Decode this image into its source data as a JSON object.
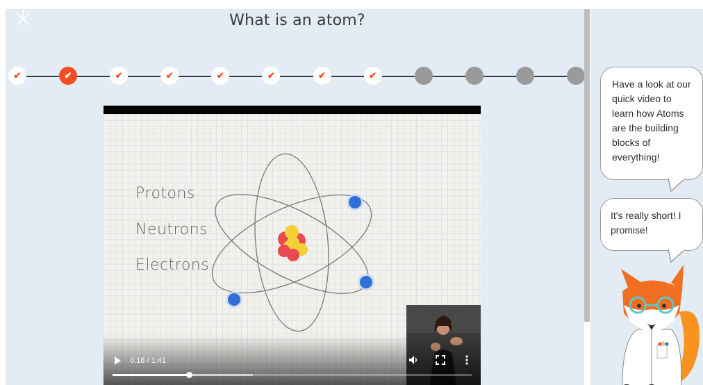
{
  "page": {
    "title": "What is an atom?"
  },
  "progress": {
    "steps": [
      {
        "state": "done"
      },
      {
        "state": "current"
      },
      {
        "state": "done"
      },
      {
        "state": "done"
      },
      {
        "state": "done"
      },
      {
        "state": "done"
      },
      {
        "state": "done"
      },
      {
        "state": "done"
      },
      {
        "state": "todo"
      },
      {
        "state": "todo"
      },
      {
        "state": "todo"
      },
      {
        "state": "todo"
      }
    ],
    "check_glyph": "✔",
    "colors": {
      "done_check": "#f04e23",
      "current_fill": "#f04e23",
      "todo_fill": "#9a9a9a"
    }
  },
  "video": {
    "labels": [
      "Protons",
      "Neutrons",
      "Electrons"
    ],
    "time_display": "0:18 / 1:41",
    "played_fraction": 0.214,
    "buffered_fraction": 0.39,
    "icons": {
      "play": "play-icon",
      "volume": "volume-icon",
      "fullscreen": "fullscreen-icon",
      "more": "more-vert-icon"
    }
  },
  "sidebar": {
    "bubble1": "Have a look at our quick video to learn how Atoms are the building blocks of everything!",
    "bubble2": "It's really short! I promise!"
  }
}
